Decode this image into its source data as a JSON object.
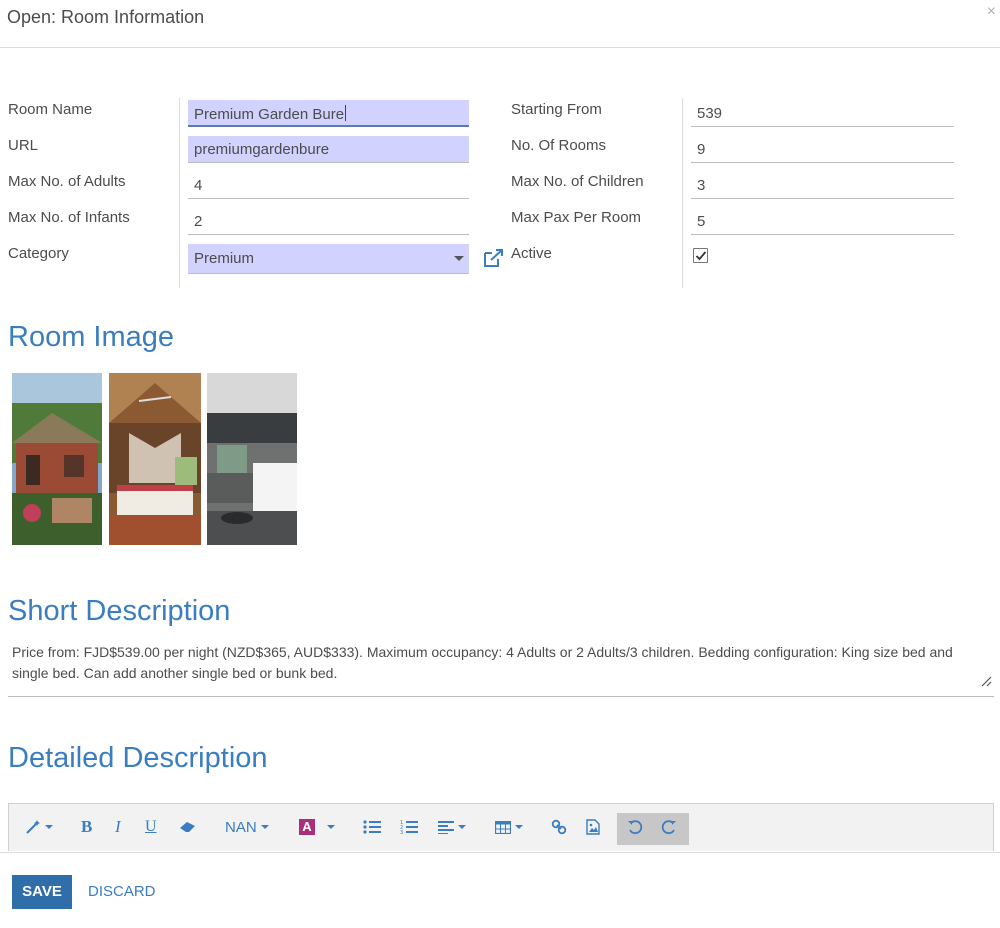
{
  "modal": {
    "title": "Open: Room Information",
    "close_glyph": "×"
  },
  "form": {
    "room_name": {
      "label": "Room Name",
      "value": "Premium Garden Bure"
    },
    "url": {
      "label": "URL",
      "value": "premiumgardenbure"
    },
    "max_adults": {
      "label": "Max No. of Adults",
      "value": "4"
    },
    "max_infants": {
      "label": "Max No. of Infants",
      "value": "2"
    },
    "category": {
      "label": "Category",
      "value": "Premium"
    },
    "starting_from": {
      "label": "Starting From",
      "value": "539"
    },
    "no_of_rooms": {
      "label": "No. Of Rooms",
      "value": "9"
    },
    "max_children": {
      "label": "Max No. of Children",
      "value": "3"
    },
    "max_pax": {
      "label": "Max Pax Per Room",
      "value": "5"
    },
    "active": {
      "label": "Active",
      "checked": true
    }
  },
  "sections": {
    "room_image": "Room Image",
    "short_description": "Short Description",
    "detailed_description": "Detailed Description"
  },
  "short_description_text": "Price from: FJD$539.00 per night (NZD$365, AUD$333). Maximum occupancy: 4 Adults or 2 Adults/3 children. Bedding configuration: King size bed and single bed. Can add another single bed or bunk bed.",
  "toolbar": {
    "buttons": [
      {
        "name": "style-icon",
        "dropdown": true
      },
      {
        "name": "bold-icon",
        "text": "B"
      },
      {
        "name": "italic-icon",
        "text": "I"
      },
      {
        "name": "underline-icon",
        "text": "U"
      },
      {
        "name": "eraser-icon"
      },
      {
        "name": "font-size",
        "text": "NAN",
        "dropdown": true
      },
      {
        "name": "font-color-icon",
        "text": "A",
        "dropdown": true
      },
      {
        "name": "unordered-list-icon"
      },
      {
        "name": "ordered-list-icon"
      },
      {
        "name": "align-icon",
        "dropdown": true
      },
      {
        "name": "table-icon",
        "dropdown": true
      },
      {
        "name": "link-icon"
      },
      {
        "name": "image-icon"
      },
      {
        "name": "undo-icon"
      },
      {
        "name": "redo-icon"
      }
    ],
    "font_size_label": "NAN",
    "bold_label": "B",
    "italic_label": "I",
    "underline_label": "U",
    "color_label": "A"
  },
  "footer": {
    "save_label": "SAVE",
    "discard_label": "DISCARD"
  },
  "colors": {
    "accent": "#3a7dc0",
    "required_field": "#d2d2ff",
    "save_button": "#2f6ea8"
  }
}
